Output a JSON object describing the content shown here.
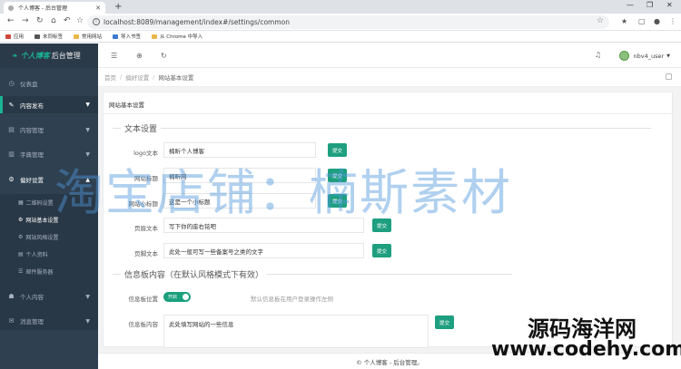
{
  "browser": {
    "tab_title": "个人博客 - 后台管理",
    "url": "localhost:8089/management/index#/settings/common",
    "bookmarks": [
      {
        "label": "应用",
        "color": "#d0463b"
      },
      {
        "label": "未同标签",
        "color": "#555555"
      },
      {
        "label": "常用网站",
        "color": "#e8b84a"
      },
      {
        "label": "导入书签",
        "color": "#3b7bd0"
      },
      {
        "label": "从 Chrome 中导入",
        "color": "#e8b84a"
      }
    ]
  },
  "sidebar": {
    "brand_a": "个人博客",
    "brand_b": "后台管理",
    "items": [
      {
        "label": "仪表盘",
        "icon": "dashboard-icon"
      },
      {
        "label": "内容发布",
        "icon": "pencil-icon"
      },
      {
        "label": "内容管理",
        "icon": "folder-icon"
      },
      {
        "label": "字典管理",
        "icon": "book-icon"
      },
      {
        "label": "偏好设置",
        "icon": "gear-icon"
      },
      {
        "label": "个人内容",
        "icon": "user-icon"
      },
      {
        "label": "消息管理",
        "icon": "message-icon"
      }
    ],
    "subitems": [
      {
        "label": "二维码设置"
      },
      {
        "label": "网站基本设置"
      },
      {
        "label": "网站风格设置"
      },
      {
        "label": "个人资料"
      },
      {
        "label": "邮件服务器"
      }
    ]
  },
  "topbar": {
    "username": "nbv4_user"
  },
  "breadcrumb": [
    "首页",
    "偏好设置",
    "网站基本设置"
  ],
  "panel": {
    "title": "网站基本设置",
    "section1": "文本设置",
    "section2": "信息板内容（在默认风格模式下有效）",
    "submit_label": "提交",
    "rows": [
      {
        "label": "logo文本",
        "value": "楠昕个人博客"
      },
      {
        "label": "网站标题",
        "value": "楠昕网"
      },
      {
        "label": "网站小标题",
        "value": "这是一个小标题"
      },
      {
        "label": "页眉文本",
        "value": "写下你的座右铭吧"
      },
      {
        "label": "页脚文本",
        "value": "此处一般可写一些备案号之类的文字"
      }
    ],
    "board_position_label": "信息板位置",
    "toggle_label": "开启",
    "board_hint": "默认信息板在用户登录操作左侧",
    "board_content_label": "信息板内容",
    "board_content_value": "此处填写网站的一些信息"
  },
  "footer": "© 个人博客 - 后台管理。",
  "watermarks": {
    "main": "淘宝店铺：楠斯素材",
    "site_cn": "源码海洋网",
    "site_url": "www.codehy.com"
  }
}
